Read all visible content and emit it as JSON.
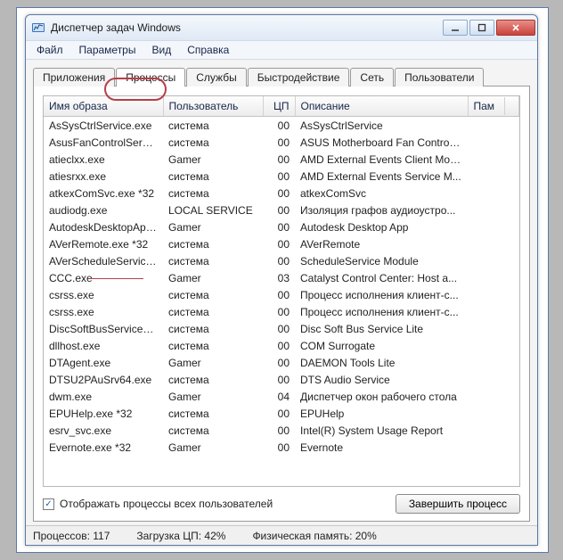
{
  "window": {
    "title": "Диспетчер задач Windows"
  },
  "menubar": {
    "file": "Файл",
    "options": "Параметры",
    "view": "Вид",
    "help": "Справка"
  },
  "tabs": {
    "apps": "Приложения",
    "processes": "Процессы",
    "services": "Службы",
    "performance": "Быстродействие",
    "network": "Сеть",
    "users": "Пользователи"
  },
  "columns": {
    "image_name": "Имя образа",
    "user": "Пользователь",
    "cpu": "ЦП",
    "description": "Описание",
    "memory": "Пам"
  },
  "rows": [
    {
      "name": "AsSysCtrlService.exe",
      "user": "система",
      "cpu": "00",
      "desc": "AsSysCtrlService"
    },
    {
      "name": "AsusFanControlServic...",
      "user": "система",
      "cpu": "00",
      "desc": "ASUS Motherboard Fan Control ..."
    },
    {
      "name": "atieclxx.exe",
      "user": "Gamer",
      "cpu": "00",
      "desc": "AMD External Events Client Mod..."
    },
    {
      "name": "atiesrxx.exe",
      "user": "система",
      "cpu": "00",
      "desc": "AMD External Events Service M..."
    },
    {
      "name": "atkexComSvc.exe *32",
      "user": "система",
      "cpu": "00",
      "desc": "atkexComSvc"
    },
    {
      "name": "audiodg.exe",
      "user": "LOCAL SERVICE",
      "cpu": "00",
      "desc": "Изоляция графов аудиоустро..."
    },
    {
      "name": "AutodeskDesktopApp...",
      "user": "Gamer",
      "cpu": "00",
      "desc": "Autodesk Desktop App"
    },
    {
      "name": "AVerRemote.exe *32",
      "user": "система",
      "cpu": "00",
      "desc": "AVerRemote"
    },
    {
      "name": "AVerScheduleService....",
      "user": "система",
      "cpu": "00",
      "desc": "ScheduleService Module"
    },
    {
      "name": "CCC.exe",
      "user": "Gamer",
      "cpu": "03",
      "desc": "Catalyst Control Center: Host a..."
    },
    {
      "name": "csrss.exe",
      "user": "система",
      "cpu": "00",
      "desc": "Процесс исполнения клиент-с..."
    },
    {
      "name": "csrss.exe",
      "user": "система",
      "cpu": "00",
      "desc": "Процесс исполнения клиент-с..."
    },
    {
      "name": "DiscSoftBusServiceLit...",
      "user": "система",
      "cpu": "00",
      "desc": "Disc Soft Bus Service Lite"
    },
    {
      "name": "dllhost.exe",
      "user": "система",
      "cpu": "00",
      "desc": "COM Surrogate"
    },
    {
      "name": "DTAgent.exe",
      "user": "Gamer",
      "cpu": "00",
      "desc": "DAEMON Tools Lite"
    },
    {
      "name": "DTSU2PAuSrv64.exe",
      "user": "система",
      "cpu": "00",
      "desc": "DTS Audio Service"
    },
    {
      "name": "dwm.exe",
      "user": "Gamer",
      "cpu": "04",
      "desc": "Диспетчер окон рабочего стола"
    },
    {
      "name": "EPUHelp.exe *32",
      "user": "система",
      "cpu": "00",
      "desc": "EPUHelp"
    },
    {
      "name": "esrv_svc.exe",
      "user": "система",
      "cpu": "00",
      "desc": "Intel(R) System Usage Report"
    },
    {
      "name": "Evernote.exe *32",
      "user": "Gamer",
      "cpu": "00",
      "desc": "Evernote"
    }
  ],
  "checkbox": {
    "label": "Отображать процессы всех пользователей",
    "checked": true
  },
  "buttons": {
    "end_process": "Завершить процесс"
  },
  "status": {
    "processes": "Процессов: 117",
    "cpu_load": "Загрузка ЦП: 42%",
    "phys_mem": "Физическая память: 20%"
  }
}
